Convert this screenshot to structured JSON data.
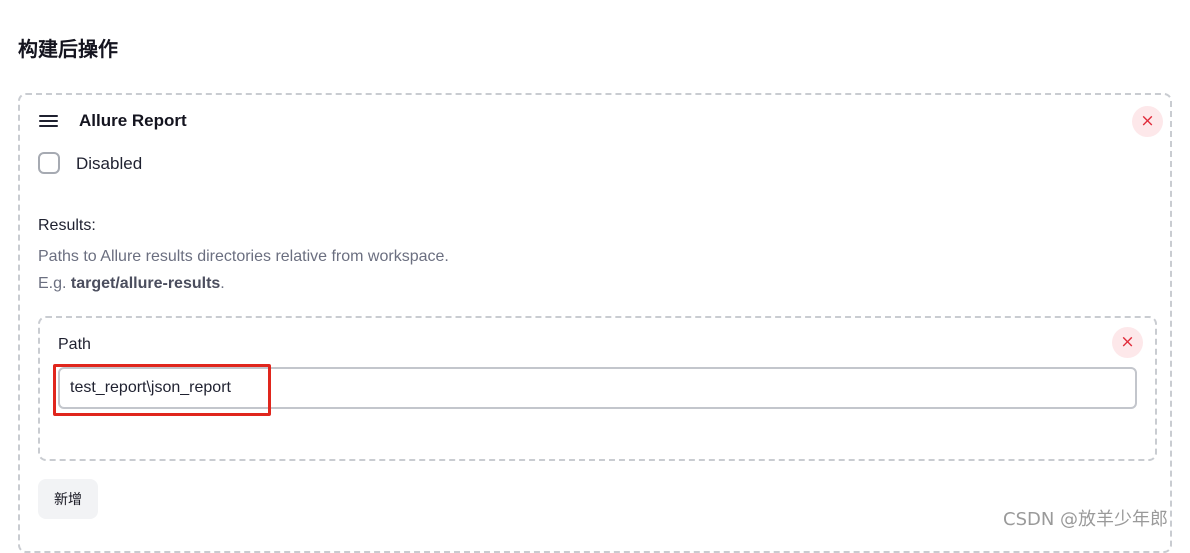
{
  "section": {
    "title": "构建后操作"
  },
  "step": {
    "title": "Allure Report",
    "drag_icon": "hamburger-icon",
    "close_symbol": "×",
    "disabled_label": "Disabled",
    "disabled_checked": false
  },
  "results": {
    "label": "Results:",
    "help_line_1": "Paths to Allure results directories relative from workspace.",
    "help_example_prefix": "E.g. ",
    "help_example_value": "target/allure-results",
    "help_example_suffix": ".",
    "path": {
      "label": "Path",
      "value": "test_report\\json_report",
      "close_symbol": "×"
    },
    "add_button": "新增"
  },
  "watermark": "CSDN @放羊少年郎",
  "colors": {
    "close_bg": "#fde8ea",
    "close_fg": "#e02b3a",
    "highlight": "#e0261d",
    "dashed_border": "#c9ccd1",
    "help_text": "#6b6f80"
  }
}
